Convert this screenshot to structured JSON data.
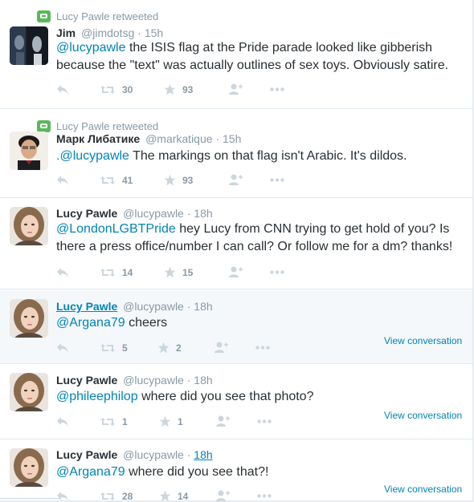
{
  "tweets": [
    {
      "retweet_context": "Lucy Pawle retweeted",
      "name": "Jim",
      "handle": "@jimdotsg",
      "time": "15h",
      "text_mention": "@lucypawle",
      "text": " the ISIS flag at the Pride parade looked like gibberish because the \"text\" was actually outlines of sex toys. Obviously satire.",
      "retweets": "30",
      "likes": "93"
    },
    {
      "retweet_context": "Lucy Pawle retweeted",
      "name": "Марк Либатике",
      "handle": "@markatique",
      "time": "15h",
      "text_mention": ".@lucypawle",
      "text": " The markings on that flag isn't Arabic. It's dildos.",
      "retweets": "41",
      "likes": "93"
    },
    {
      "name": "Lucy Pawle",
      "handle": "@lucypawle",
      "time": "18h",
      "text_mention": "@LondonLGBTPride",
      "text": " hey Lucy from CNN trying to get hold of you? Is there a press office/number I can call? Or follow me for a dm? thanks!",
      "retweets": "14",
      "likes": "15"
    },
    {
      "name": "Lucy Pawle",
      "handle": "@lucypawle",
      "time": "18h",
      "text_mention": "@Argana79",
      "text": " cheers",
      "retweets": "5",
      "likes": "2",
      "view_conversation": "View conversation"
    },
    {
      "name": "Lucy Pawle",
      "handle": "@lucypawle",
      "time": "18h",
      "text_mention": "@phileephilop",
      "text": " where did you see that photo?",
      "retweets": "1",
      "likes": "1",
      "view_conversation": "View conversation"
    },
    {
      "name": "Lucy Pawle",
      "handle": "@lucypawle",
      "time": "18h",
      "text_mention": "@Argana79",
      "text": " where did you see that?!",
      "retweets": "28",
      "likes": "14",
      "view_conversation": "View conversation"
    }
  ],
  "colors": {
    "link": "#0084b4",
    "muted": "#8899a6",
    "retweet_badge": "#5bb75b",
    "highlight_row": "#f5f8fa"
  }
}
